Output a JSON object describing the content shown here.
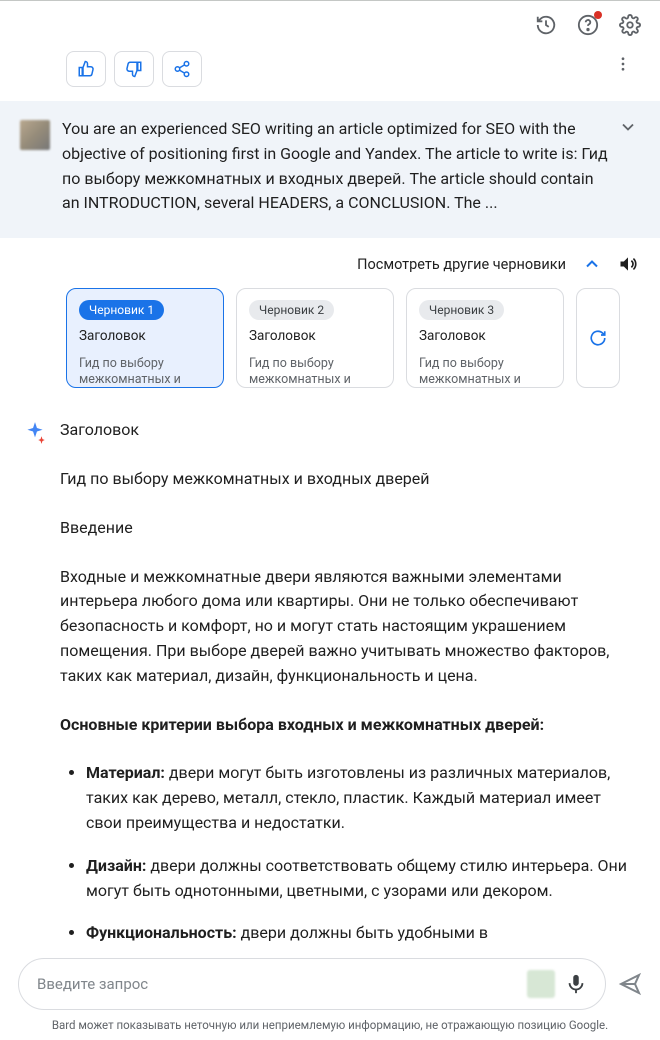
{
  "topbar": {
    "icons": [
      "history",
      "help",
      "settings"
    ]
  },
  "actions": {
    "like": "like",
    "dislike": "dislike",
    "share": "share",
    "more": "more"
  },
  "prompt": {
    "text": "You are an experienced SEO writing an article optimized for SEO with the objective of positioning first in Google and Yandex. The article to write is: Гид по выбору межкомнатных и входных дверей. The article should contain an INTRODUCTION, several HEADERS, a CONCLUSION. The ..."
  },
  "drafts": {
    "view_other": "Посмотреть другие черновики",
    "cards": [
      {
        "chip": "Черновик 1",
        "head": "Заголовок",
        "snippet": "Гид по выбору межкомнатных и"
      },
      {
        "chip": "Черновик 2",
        "head": "Заголовок",
        "snippet": "Гид по выбору межкомнатных и"
      },
      {
        "chip": "Черновик 3",
        "head": "Заголовок",
        "snippet": "Гид по выбору межкомнатных и"
      }
    ]
  },
  "article": {
    "heading": "Заголовок",
    "title": "Гид по выбору межкомнатных и входных дверей",
    "intro_label": "Введение",
    "intro_text": "Входные и межкомнатные двери являются важными элементами интерьера любого дома или квартиры. Они не только обеспечивают безопасность и комфорт, но и могут стать настоящим украшением помещения. При выборе дверей важно учитывать множество факторов, таких как материал, дизайн, функциональность и цена.",
    "criteria_head": "Основные критерии выбора входных и межкомнатных дверей:",
    "items": [
      {
        "label": "Материал:",
        "text": " двери могут быть изготовлены из различных материалов, таких как дерево, металл, стекло, пластик. Каждый материал имеет свои преимущества и недостатки."
      },
      {
        "label": "Дизайн:",
        "text": " двери должны соответствовать общему стилю интерьера. Они могут быть однотонными, цветными, с узорами или декором."
      },
      {
        "label": "Функциональность:",
        "text": " двери должны быть удобными в"
      }
    ]
  },
  "input": {
    "placeholder": "Введите запрос"
  },
  "disclaimer": "Bard может показывать неточную или неприемлемую информацию, не отражающую позицию Google."
}
